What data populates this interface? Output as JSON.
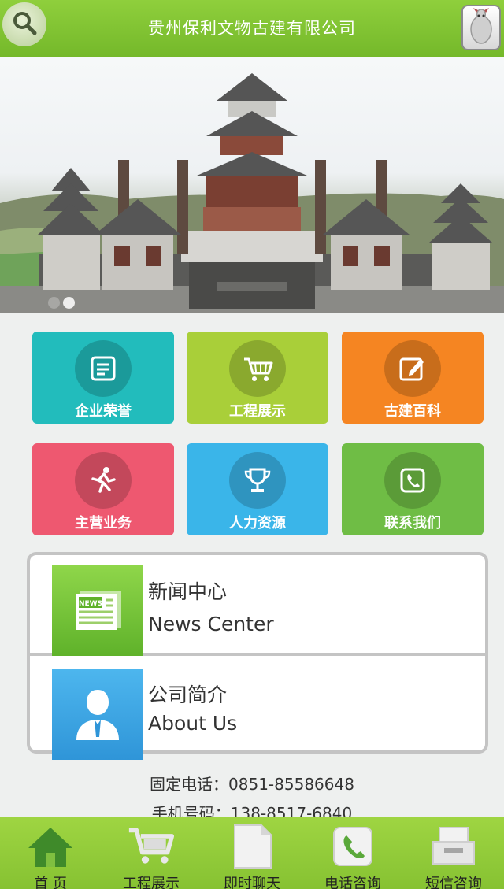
{
  "header": {
    "title": "贵州保利文物古建有限公司"
  },
  "banner": {
    "slides": 2,
    "active_slide": 2
  },
  "tiles": [
    {
      "label": "企业荣誉",
      "icon": "document-icon",
      "color": "#22bcbc"
    },
    {
      "label": "工程展示",
      "icon": "cart-icon",
      "color": "#a9cf39"
    },
    {
      "label": "古建百科",
      "icon": "edit-icon",
      "color": "#f58522"
    },
    {
      "label": "主营业务",
      "icon": "runner-icon",
      "color": "#ee5870"
    },
    {
      "label": "人力资源",
      "icon": "trophy-icon",
      "color": "#3ab5e9"
    },
    {
      "label": "联系我们",
      "icon": "phone-icon",
      "color": "#6fbd45"
    }
  ],
  "panel": {
    "rows": [
      {
        "title_cn": "新闻中心",
        "title_en": "News Center",
        "icon": "news-icon",
        "color": "#7ec63d"
      },
      {
        "title_cn": "公司简介",
        "title_en": "About Us",
        "icon": "person-icon",
        "color": "#3aa7e8"
      }
    ]
  },
  "contact": {
    "tel": "固定电话：0851-85586648",
    "mobile": "手机号码：138-8517-6840"
  },
  "bottom_nav": [
    {
      "label": "首 页",
      "icon": "home-icon"
    },
    {
      "label": "工程展示",
      "icon": "cart-icon"
    },
    {
      "label": "即时聊天",
      "icon": "chat-icon"
    },
    {
      "label": "电话咨询",
      "icon": "phone-icon"
    },
    {
      "label": "短信咨询",
      "icon": "message-icon"
    }
  ]
}
